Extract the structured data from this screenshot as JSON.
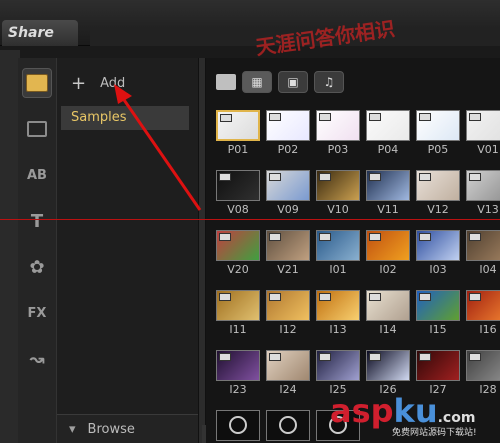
{
  "topbar": {
    "share_label": "Share"
  },
  "sidebar": {
    "icons": [
      {
        "name": "media-library-icon"
      },
      {
        "name": "transition-icon"
      },
      {
        "name": "title-ab-icon",
        "glyph": "AB"
      },
      {
        "name": "text-title-icon",
        "glyph": "T"
      },
      {
        "name": "graphic-icon",
        "glyph": "✿"
      },
      {
        "name": "fx-icon",
        "glyph": "FX"
      },
      {
        "name": "path-icon",
        "glyph": "↝"
      }
    ]
  },
  "library": {
    "add_label": "Add",
    "selected_folder": "Samples",
    "browse_label": "Browse"
  },
  "gallery": {
    "rows": [
      [
        {
          "label": "P01",
          "colors": [
            "#f5f5f5",
            "#dcdcdc"
          ]
        },
        {
          "label": "P02",
          "colors": [
            "#ffffff",
            "#e8e8ff"
          ]
        },
        {
          "label": "P03",
          "colors": [
            "#ffffff",
            "#f0e0f0"
          ]
        },
        {
          "label": "P04",
          "colors": [
            "#fbfbfb",
            "#eaeaea"
          ]
        },
        {
          "label": "P05",
          "colors": [
            "#ffffff",
            "#dde8f5"
          ]
        },
        {
          "label": "V01",
          "colors": [
            "#f2f2f2",
            "#e0e0e0"
          ]
        }
      ],
      [
        {
          "label": "V08",
          "colors": [
            "#101010",
            "#303030"
          ]
        },
        {
          "label": "V09",
          "colors": [
            "#d8d8d8",
            "#7a9ad0"
          ]
        },
        {
          "label": "V10",
          "colors": [
            "#3a2a10",
            "#caa050"
          ]
        },
        {
          "label": "V11",
          "colors": [
            "#203050",
            "#a0b8e0"
          ]
        },
        {
          "label": "V12",
          "colors": [
            "#e8e0d8",
            "#c0b0a0"
          ]
        },
        {
          "label": "V13",
          "colors": [
            "#d0d0d0",
            "#909090"
          ]
        }
      ],
      [
        {
          "label": "V20",
          "colors": [
            "#c04040",
            "#40a040"
          ]
        },
        {
          "label": "V21",
          "colors": [
            "#605040",
            "#c0a080"
          ]
        },
        {
          "label": "I01",
          "colors": [
            "#2a5a8a",
            "#8ab0d0"
          ]
        },
        {
          "label": "I02",
          "colors": [
            "#c05010",
            "#f0a020"
          ]
        },
        {
          "label": "I03",
          "colors": [
            "#3050a0",
            "#c0d0f0"
          ]
        },
        {
          "label": "I04",
          "colors": [
            "#504030",
            "#a08060"
          ]
        }
      ],
      [
        {
          "label": "I11",
          "colors": [
            "#a07020",
            "#e0c070"
          ]
        },
        {
          "label": "I12",
          "colors": [
            "#b07830",
            "#f0c060"
          ]
        },
        {
          "label": "I13",
          "colors": [
            "#c07010",
            "#f8d070"
          ]
        },
        {
          "label": "I14",
          "colors": [
            "#e8e0d0",
            "#b0a090"
          ]
        },
        {
          "label": "I15",
          "colors": [
            "#2060c0",
            "#60a030"
          ]
        },
        {
          "label": "I16",
          "colors": [
            "#a02010",
            "#f08030"
          ]
        }
      ],
      [
        {
          "label": "I23",
          "colors": [
            "#201030",
            "#8050a0"
          ]
        },
        {
          "label": "I24",
          "colors": [
            "#e0d0c0",
            "#a08870"
          ]
        },
        {
          "label": "I25",
          "colors": [
            "#202040",
            "#a0a0d0"
          ]
        },
        {
          "label": "I26",
          "colors": [
            "#0a0a20",
            "#d0d8f0"
          ]
        },
        {
          "label": "I27",
          "colors": [
            "#300808",
            "#a02020"
          ]
        },
        {
          "label": "I28",
          "colors": [
            "#404040",
            "#909090"
          ]
        }
      ]
    ],
    "bottom_row_count": 3
  },
  "watermark": {
    "text": "天涯问答你相识"
  },
  "logo": {
    "text_asp": "asp",
    "text_ku": "ku",
    "text_dom": ".com",
    "sub": "免费网站源码下载站!"
  }
}
